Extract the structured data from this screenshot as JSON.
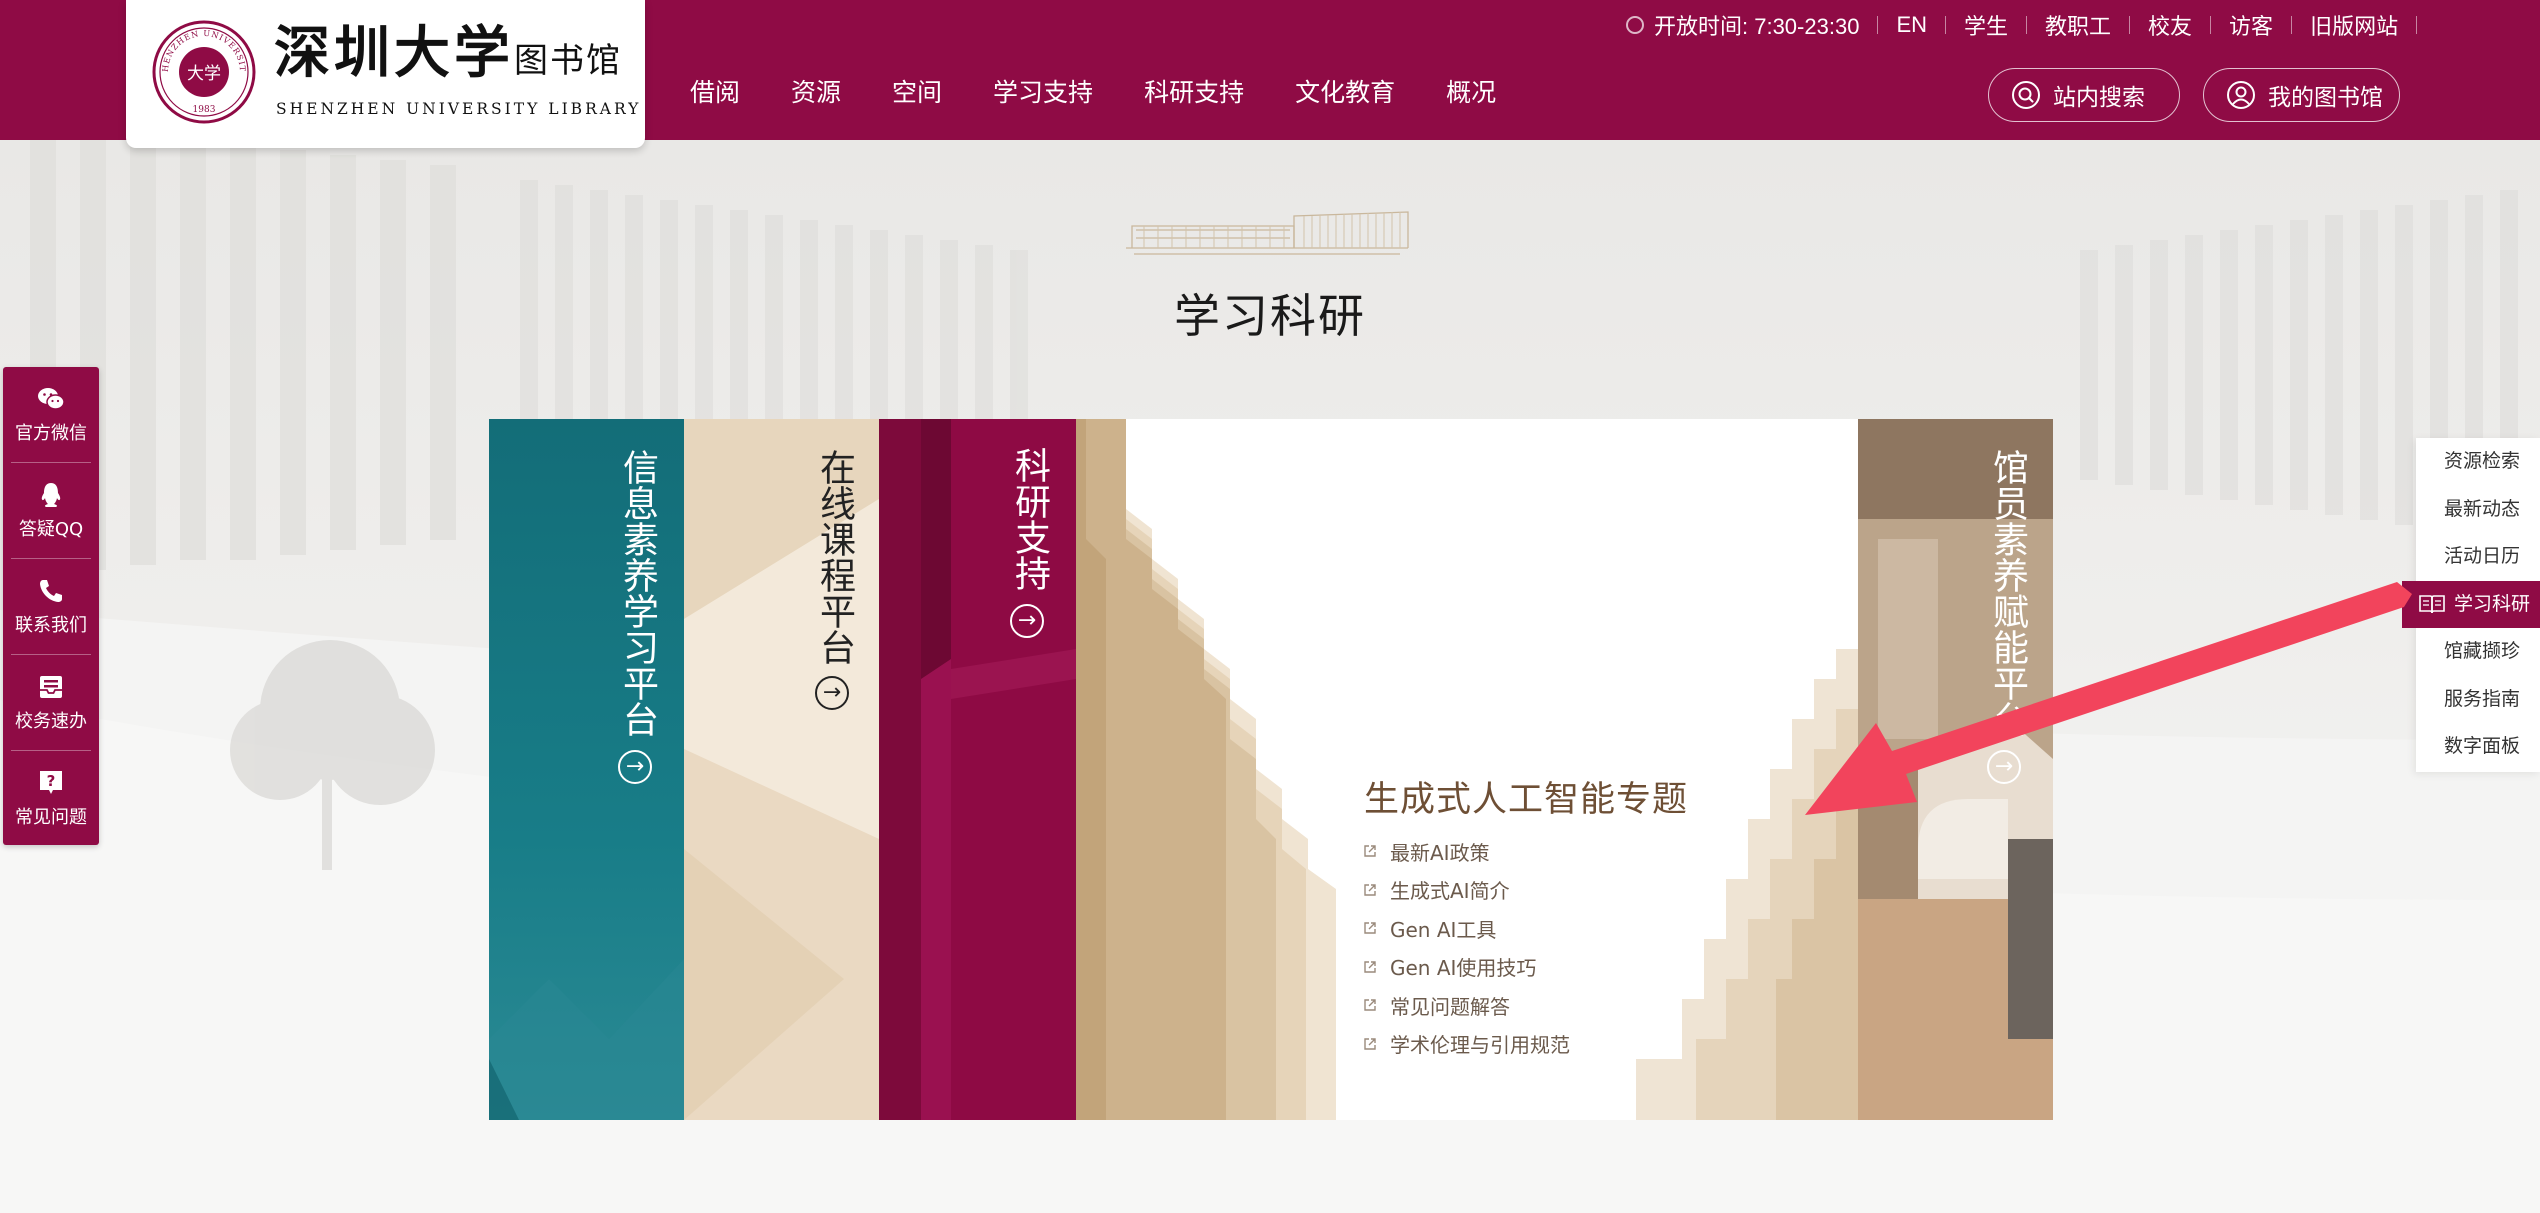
{
  "logo": {
    "cn_name": "深圳大学",
    "cn_suffix": "图书馆",
    "en_name": "SHENZHEN UNIVERSITY LIBRARY",
    "seal_chars": "大学",
    "seal_text_top": "SHENZHEN UNIVERSITY",
    "seal_year": "1983"
  },
  "topbar": {
    "hours": "开放时间: 7:30-23:30",
    "links": [
      "EN",
      "学生",
      "教职工",
      "校友",
      "访客",
      "旧版网站"
    ]
  },
  "nav": {
    "items": [
      "借阅",
      "资源",
      "空间",
      "学习支持",
      "科研支持",
      "文化教育",
      "概况"
    ]
  },
  "header_buttons": {
    "search": "站内搜索",
    "my_library": "我的图书馆"
  },
  "section": {
    "title": "学习科研"
  },
  "panels": [
    {
      "title": "信息素养学习平台"
    },
    {
      "title": "在线课程平台"
    },
    {
      "title": "科研支持"
    },
    {
      "title": "馆员素养赋能平台"
    }
  ],
  "ai_topic": {
    "title": "生成式人工智能专题",
    "links": [
      "最新AI政策",
      "生成式AI简介",
      "Gen AI工具",
      "Gen AI使用技巧",
      "常见问题解答",
      "学术伦理与引用规范"
    ]
  },
  "left_bar": {
    "items": [
      "官方微信",
      "答疑QQ",
      "联系我们",
      "校务速办",
      "常见问题"
    ]
  },
  "right_menu": {
    "items": [
      "资源检索",
      "最新动态",
      "活动日历",
      "学习科研",
      "馆藏撷珍",
      "服务指南",
      "数字面板"
    ],
    "active": "学习科研"
  },
  "colors": {
    "brand": "#8f0b45",
    "teal": "#136d78",
    "beige": "#efe3d0",
    "tan": "#a38a70",
    "annotation": "#f2445c"
  },
  "icons": {
    "clock": "clock-icon",
    "search": "search-icon",
    "user": "user-icon",
    "wechat": "wechat-icon",
    "qq": "qq-icon",
    "phone": "phone-icon",
    "inbox": "inbox-icon",
    "question": "question-icon",
    "book": "book-icon",
    "arrow": "arrow-right-circle-icon",
    "external": "external-link-icon"
  }
}
